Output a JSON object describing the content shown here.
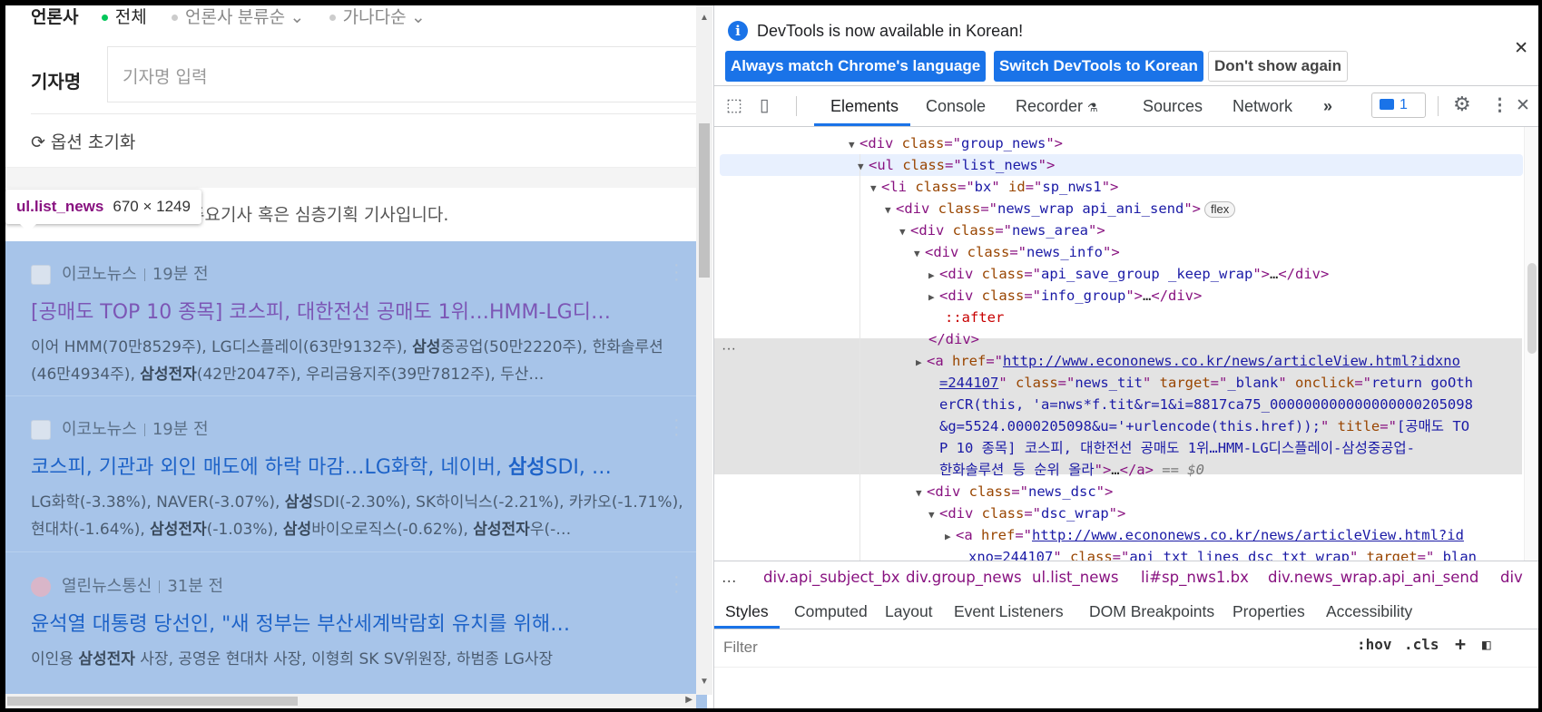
{
  "page": {
    "press_filter": [
      "전체",
      "언론사 분류순",
      "가나다순"
    ],
    "press_filter_prefix": "언론사",
    "reporter_label": "기자명",
    "reporter_placeholder": "기자명 입력",
    "reset_label": "옵션 초기화",
    "notice_text": "주요기사 혹은 심층기획 기사입니다.",
    "tooltip": {
      "selector": "ul.list_news",
      "size": "670 × 1249"
    },
    "news": [
      {
        "press": "이코노뉴스",
        "time": "19분 전",
        "title": "[공매도 TOP 10 종목] 코스피, 대한전선 공매도 1위…HMM-LG디…",
        "desc_html": "이어 HMM(70만8529주), LG디스플레이(63만9132주), <b>삼성</b>중공업(50만2220주), 한화솔루션(46만4934주), <b>삼성전자</b>(42만2047주), 우리금융지주(39만7812주), 두산…"
      },
      {
        "press": "이코노뉴스",
        "time": "19분 전",
        "title_html": "코스피, 기관과 외인 매도에 하락 마감…LG화학, 네이버, <b>삼성</b>SDI, …",
        "desc_html": "LG화학(-3.38%), NAVER(-3.07%), <b>삼성</b>SDI(-2.30%), SK하이닉스(-2.21%), 카카오(-1.71%), 현대차(-1.64%), <b>삼성전자</b>(-1.03%), <b>삼성</b>바이오로직스(-0.62%), <b>삼성전자</b>우(-…"
      },
      {
        "press": "열린뉴스통신",
        "time": "31분 전",
        "title": "윤석열 대통령 당선인, \"새 정부는 부산세계박람회 유치를 위해…",
        "desc_html": "이인용 <b>삼성전자</b> 사장, 공영운 현대차 사장, 이형희 SK SV위원장, 하범종 LG사장"
      }
    ]
  },
  "devtools": {
    "info_message": "DevTools is now available in Korean!",
    "btn_match": "Always match Chrome's language",
    "btn_switch": "Switch DevTools to Korean",
    "btn_dont_show": "Don't show again",
    "tabs": [
      "Elements",
      "Console",
      "Recorder",
      "Sources",
      "Network"
    ],
    "issues_count": "1",
    "breadcrumbs": [
      "div.api_subject_bx",
      "div.group_news",
      "ul.list_news",
      "li#sp_nws1.bx",
      "div.news_wrap.api_ani_send",
      "div"
    ],
    "subtabs": [
      "Styles",
      "Computed",
      "Layout",
      "Event Listeners",
      "DOM Breakpoints",
      "Properties",
      "Accessibility"
    ],
    "filter_placeholder": "Filter",
    "hov": ":hov",
    "cls": ".cls",
    "dom": [
      "<span class=\"tri\">▼</span>&lt;div <span class=\"an\">class</span>=\"<span class=\"av\">group_news</span>\"&gt;",
      "<span class=\"tri\">▼</span>&lt;ul <span class=\"an\">class</span>=\"<span class=\"av\">list_news</span>\"&gt;",
      "<span class=\"tri\">▼</span>&lt;li <span class=\"an\">class</span>=\"<span class=\"av\">bx</span>\" <span class=\"an\">id</span>=\"<span class=\"av\">sp_nws1</span>\"&gt;",
      "<span class=\"tri\">▼</span>&lt;div <span class=\"an\">class</span>=\"<span class=\"av\">news_wrap api_ani_send</span>\"&gt;<span class=\"flex-badge\">flex</span>",
      "<span class=\"tri\">▼</span>&lt;div <span class=\"an\">class</span>=\"<span class=\"av\">news_area</span>\"&gt;",
      "<span class=\"tri\">▼</span>&lt;div <span class=\"an\">class</span>=\"<span class=\"av\">news_info</span>\"&gt;",
      "<span class=\"tri\">▶</span>&lt;div <span class=\"an\">class</span>=\"<span class=\"av\">api_save_group _keep_wrap</span>\"&gt;<span class=\"tx\">…</span>&lt;/div&gt;",
      "<span class=\"tri\">▶</span>&lt;div <span class=\"an\">class</span>=\"<span class=\"av\">info_group</span>\"&gt;<span class=\"tx\">…</span>&lt;/div&gt;",
      "<span class=\"ps\">::after</span>",
      "&lt;/div&gt;",
      "<span class=\"tri\">▶</span>&lt;a <span class=\"an\">href</span>=\"<span class=\"lnk\">http://www.econonews.co.kr/news/articleView.html?idxno</span>",
      "<span class=\"lnk\">=244107</span>\" <span class=\"an\">class</span>=\"<span class=\"av\">news_tit</span>\" <span class=\"an\">target</span>=\"<span class=\"av\">_blank</span>\" <span class=\"an\">onclick</span>=\"<span class=\"av\">return goOth</span>",
      "<span class=\"av\">erCR(this, 'a=nws*f.tit&amp;r=1&amp;i=8817ca75_000000000000000000205098</span>",
      "<span class=\"av\">&amp;g=5524.0000205098&amp;u='+urlencode(this.href));</span>\" <span class=\"an\">title</span>=\"<span class=\"av\">[공매도 TO</span>",
      "<span class=\"av\">P 10 종목] 코스피, 대한전선 공매도 1위…HMM-LG디스플레이-삼성중공업-</span>",
      "<span class=\"av\">한화솔루션 등 순위 올라</span>\"&gt;<span class=\"tx\">…</span>&lt;/a&gt; <span class=\"eq\">== $0</span>",
      "<span class=\"tri\">▼</span>&lt;div <span class=\"an\">class</span>=\"<span class=\"av\">news_dsc</span>\"&gt;",
      "<span class=\"tri\">▼</span>&lt;div <span class=\"an\">class</span>=\"<span class=\"av\">dsc_wrap</span>\"&gt;",
      "<span class=\"tri\">▶</span>&lt;a <span class=\"an\">href</span>=\"<span class=\"lnk\">http://www.econonews.co.kr/news/articleView.html?id</span>",
      "<span class=\"lnk\">xno=244107</span>\" <span class=\"an\">class</span>=\"<span class=\"av\">api_txt_lines dsc_txt_wrap</span>\" <span class=\"an\">target</span>=\"<span class=\"av\">_blan</span>"
    ]
  }
}
